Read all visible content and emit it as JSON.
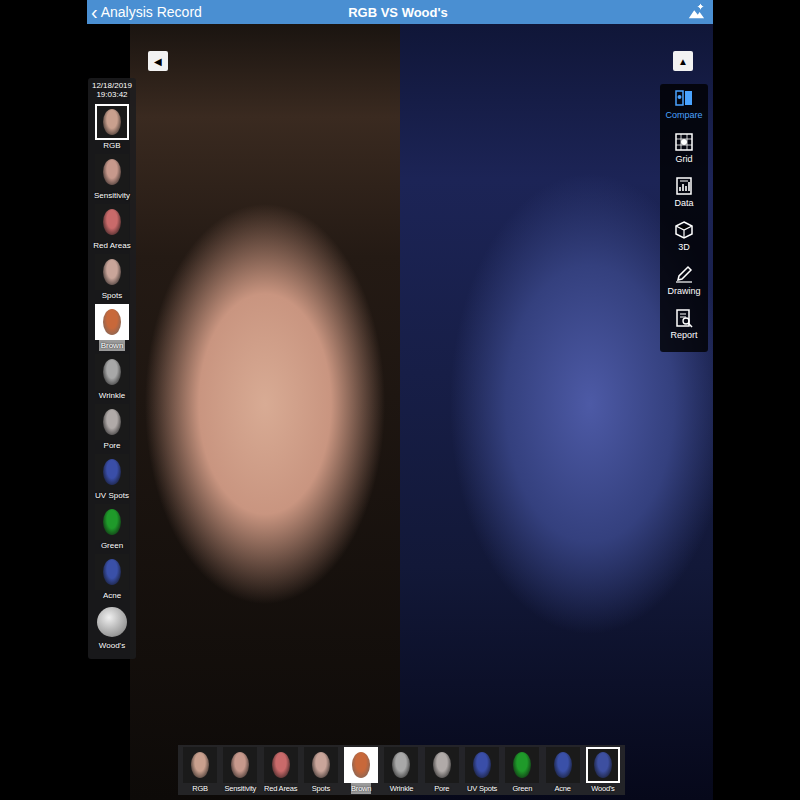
{
  "header": {
    "back_icon": "‹",
    "back_label": "Analysis Record",
    "title": "RGB VS Wood's"
  },
  "timestamp": {
    "date": "12/18/2019",
    "time": "19:03:42"
  },
  "left_arrow": "◀",
  "right_arrow": "▲",
  "sidebar": {
    "items": [
      {
        "label": "RGB",
        "selected": true,
        "highlighted": false,
        "color": "#c9a08e",
        "kind": "face"
      },
      {
        "label": "Sensitivity",
        "selected": false,
        "highlighted": false,
        "color": "#c7998c",
        "kind": "face"
      },
      {
        "label": "Red Areas",
        "selected": false,
        "highlighted": false,
        "color": "#c96a6a",
        "kind": "face"
      },
      {
        "label": "Spots",
        "selected": false,
        "highlighted": false,
        "color": "#c9a59a",
        "kind": "face"
      },
      {
        "label": "Brown",
        "selected": false,
        "highlighted": true,
        "color": "#c8683a",
        "kind": "face"
      },
      {
        "label": "Wrinkle",
        "selected": false,
        "highlighted": false,
        "color": "#a8a8a8",
        "kind": "face"
      },
      {
        "label": "Pore",
        "selected": false,
        "highlighted": false,
        "color": "#b0aaa8",
        "kind": "face"
      },
      {
        "label": "UV Spots",
        "selected": false,
        "highlighted": false,
        "color": "#3a4ea8",
        "kind": "face"
      },
      {
        "label": "Green",
        "selected": false,
        "highlighted": false,
        "color": "#1f9a2a",
        "kind": "face"
      },
      {
        "label": "Acne",
        "selected": false,
        "highlighted": false,
        "color": "#3a50a8",
        "kind": "face"
      },
      {
        "label": "Wood's",
        "selected": false,
        "highlighted": false,
        "color": "#9a9a9a",
        "kind": "button"
      }
    ]
  },
  "toolbar": {
    "items": [
      {
        "label": "Compare",
        "selected": true
      },
      {
        "label": "Grid",
        "selected": false
      },
      {
        "label": "Data",
        "selected": false
      },
      {
        "label": "3D",
        "selected": false
      },
      {
        "label": "Drawing",
        "selected": false
      },
      {
        "label": "Report",
        "selected": false
      }
    ]
  },
  "bottom_strip": {
    "items": [
      {
        "label": "RGB",
        "selected": false,
        "highlighted": false,
        "color": "#c9a08e"
      },
      {
        "label": "Sensitivity",
        "selected": false,
        "highlighted": false,
        "color": "#c7998c"
      },
      {
        "label": "Red Areas",
        "selected": false,
        "highlighted": false,
        "color": "#c96a6a"
      },
      {
        "label": "Spots",
        "selected": false,
        "highlighted": false,
        "color": "#c9a59a"
      },
      {
        "label": "Brown",
        "selected": false,
        "highlighted": true,
        "color": "#c8683a"
      },
      {
        "label": "Wrinkle",
        "selected": false,
        "highlighted": false,
        "color": "#a8a8a8"
      },
      {
        "label": "Pore",
        "selected": false,
        "highlighted": false,
        "color": "#b0aaa8"
      },
      {
        "label": "UV Spots",
        "selected": false,
        "highlighted": false,
        "color": "#3a4ea8"
      },
      {
        "label": "Green",
        "selected": false,
        "highlighted": false,
        "color": "#1f9a2a"
      },
      {
        "label": "Acne",
        "selected": false,
        "highlighted": false,
        "color": "#3a50a8"
      },
      {
        "label": "Wood's",
        "selected": true,
        "highlighted": false,
        "color": "#3d4fa0"
      }
    ]
  }
}
